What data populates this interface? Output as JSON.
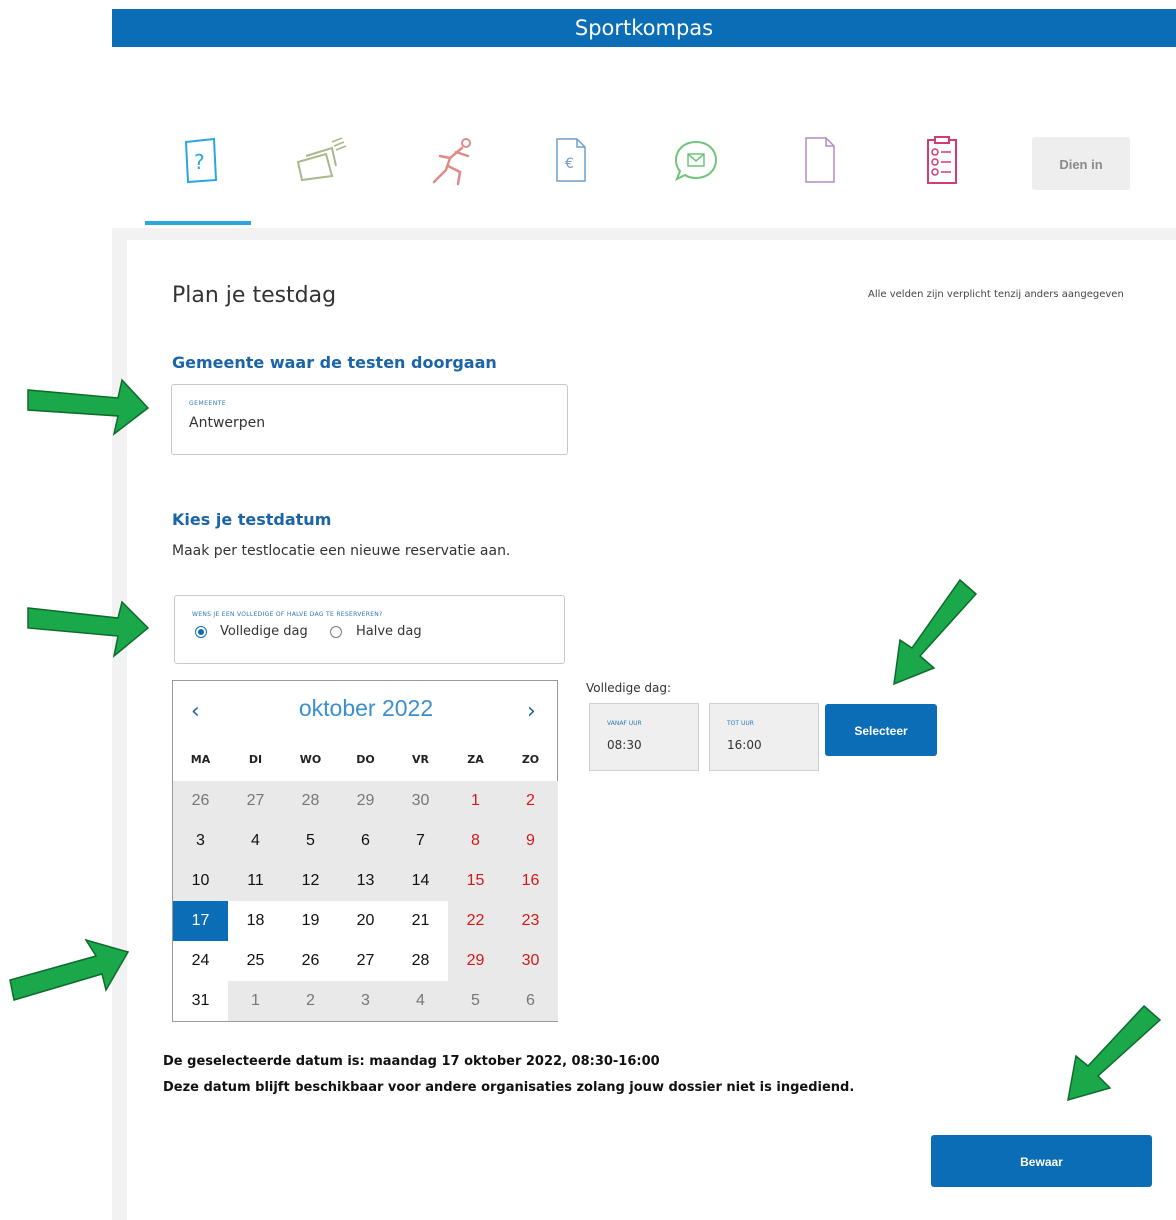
{
  "header": {
    "title": "Sportkompas"
  },
  "steps": {
    "icons": [
      "question-card-icon",
      "documents-stack-icon",
      "runner-icon",
      "euro-document-icon",
      "chat-message-icon",
      "blank-page-icon",
      "checklist-icon"
    ],
    "submit_label": "Dien in"
  },
  "page": {
    "title": "Plan je testdag",
    "required_note": "Alle velden zijn verplicht tenzij anders aangegeven"
  },
  "gemeente": {
    "heading": "Gemeente waar de testen doorgaan",
    "field_label": "GEMEENTE",
    "field_value": "Antwerpen"
  },
  "testdatum": {
    "heading": "Kies je testdatum",
    "subtext": "Maak per testlocatie een nieuwe reservatie aan.",
    "day_question": "WENS JE EEN VOLLEDIGE OF HALVE DAG TE RESERVEREN?",
    "options": [
      {
        "label": "Volledige dag",
        "selected": true
      },
      {
        "label": "Halve dag",
        "selected": false
      }
    ]
  },
  "calendar": {
    "prev": "‹",
    "next": "›",
    "month_title": "oktober 2022",
    "weekdays": [
      "MA",
      "DI",
      "WO",
      "DO",
      "VR",
      "ZA",
      "ZO"
    ],
    "weeks": [
      [
        "26",
        "27",
        "28",
        "29",
        "30",
        "1",
        "2"
      ],
      [
        "3",
        "4",
        "5",
        "6",
        "7",
        "8",
        "9"
      ],
      [
        "10",
        "11",
        "12",
        "13",
        "14",
        "15",
        "16"
      ],
      [
        "17",
        "18",
        "19",
        "20",
        "21",
        "22",
        "23"
      ],
      [
        "24",
        "25",
        "26",
        "27",
        "28",
        "29",
        "30"
      ],
      [
        "31",
        "1",
        "2",
        "3",
        "4",
        "5",
        "6"
      ]
    ],
    "selected": "17"
  },
  "time": {
    "title": "Volledige dag:",
    "from_label": "VANAF UUR",
    "from_value": "08:30",
    "to_label": "TOT UUR",
    "to_value": "16:00",
    "select_label": "Selecteer"
  },
  "summary": {
    "selected_date": "De geselecteerde datum is: maandag 17 oktober 2022, 08:30-16:00",
    "availability": "Deze datum blijft beschikbaar voor andere organisaties zolang jouw dossier niet is ingediend."
  },
  "actions": {
    "save_label": "Bewaar"
  },
  "colors": {
    "primary": "#0a6db5",
    "accent": "#2aa7dd",
    "heading": "#1b64a8",
    "weekend": "#d11a1a",
    "arrow": "#1aa84a"
  }
}
